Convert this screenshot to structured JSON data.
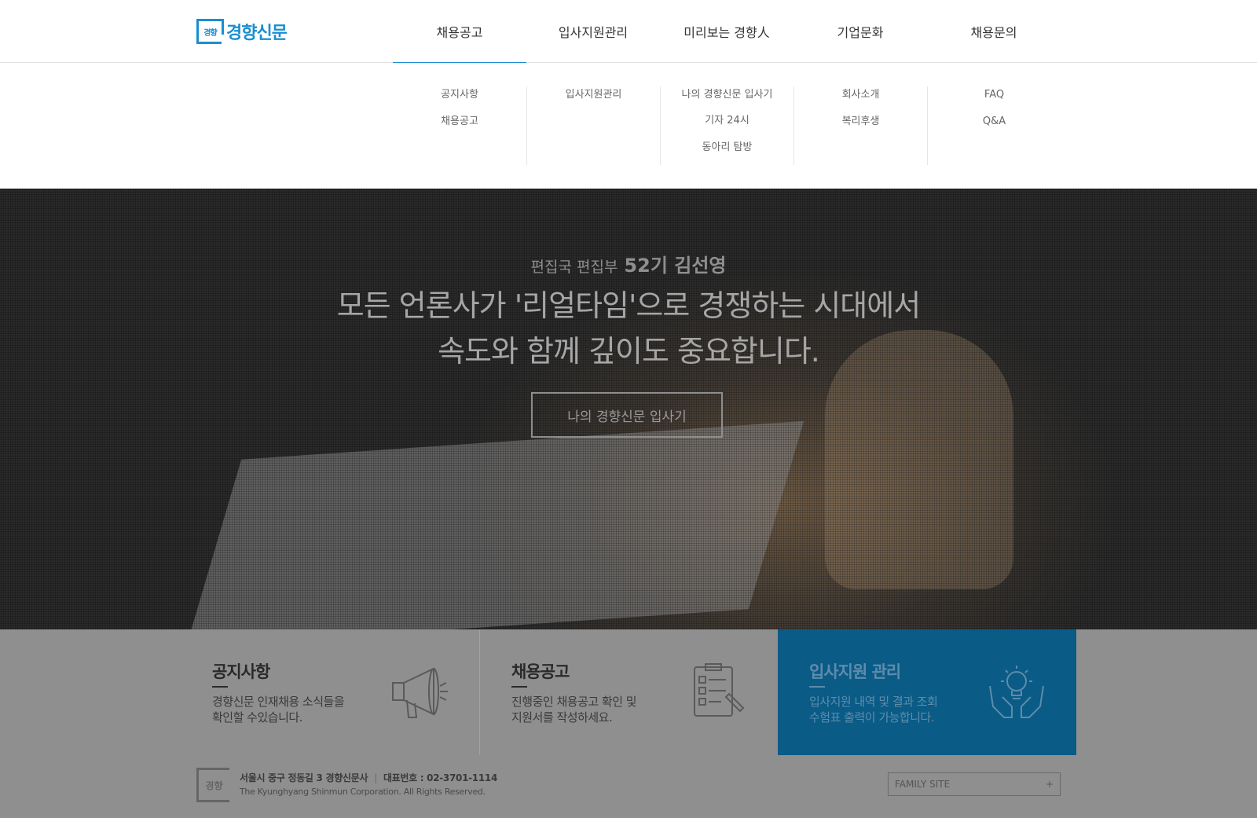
{
  "brand": {
    "logo_mark": "경향",
    "logo_text": "경향신문",
    "color": "#1a8ed2"
  },
  "gnb": [
    {
      "label": "채용공고",
      "active": true
    },
    {
      "label": "입사지원관리"
    },
    {
      "label": "미리보는 경향人"
    },
    {
      "label": "기업문화"
    },
    {
      "label": "채용문의"
    }
  ],
  "submenu": [
    [
      "공지사항",
      "채용공고"
    ],
    [
      "입사지원관리"
    ],
    [
      "나의 경향신문 입사기",
      "기자 24시",
      "동아리 탐방"
    ],
    [
      "회사소개",
      "복리후생"
    ],
    [
      "FAQ",
      "Q&A"
    ]
  ],
  "hero": {
    "dept": "편집국 편집부",
    "name": "52기 김선영",
    "title_line1": "모든 언론사가 '리얼타임'으로 경쟁하는 시대에서",
    "title_line2": "속도와 함께 깊이도 중요합니다.",
    "button": "나의 경향신문 입사기"
  },
  "quick": [
    {
      "title": "공지사항",
      "desc1": "경향신문 인재채용 소식들을",
      "desc2": "확인할 수있습니다.",
      "icon": "megaphone-icon"
    },
    {
      "title": "채용공고",
      "desc1": "진행중인 채용공고 확인 및",
      "desc2": "지원서를 작성하세요.",
      "icon": "checklist-icon"
    },
    {
      "title": "입사지원 관리",
      "desc1": "입사지원 내역 및 결과 조회",
      "desc2": "수험표 출력이 가능합니다.",
      "icon": "lightbulb-hands-icon",
      "color": "#0a5b86"
    }
  ],
  "footer": {
    "logo_mark": "경향",
    "address": "서울시 중구 정동길 3 경향신문사",
    "separator": "|",
    "phone": "대표번호 : 02-3701-1114",
    "copyright": "The Kyunghyang Shinmun Corporation. All Rights Reserved.",
    "family_site": "FAMILY SITE",
    "family_plus": "+"
  }
}
